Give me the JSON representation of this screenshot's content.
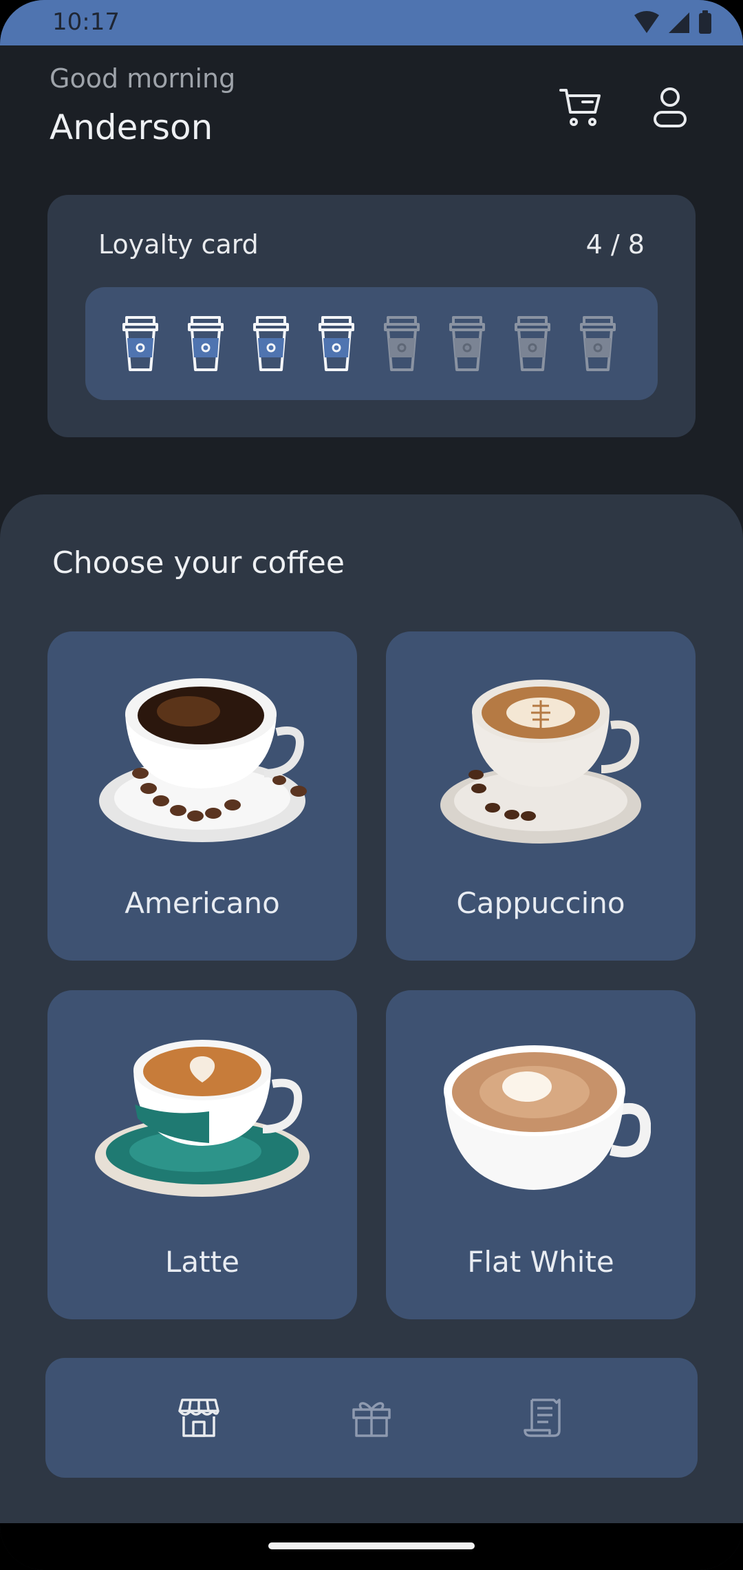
{
  "status": {
    "time": "10:17"
  },
  "header": {
    "greeting": "Good morning",
    "name": "Anderson"
  },
  "loyalty": {
    "title": "Loyalty card",
    "count_text": "4 / 8",
    "stamps_earned": 4,
    "stamps_total": 8
  },
  "section": {
    "title": "Choose your coffee"
  },
  "coffees": [
    {
      "label": "Americano",
      "image": "americano-cup-image"
    },
    {
      "label": "Cappuccino",
      "image": "cappuccino-cup-image"
    },
    {
      "label": "Latte",
      "image": "latte-cup-image"
    },
    {
      "label": "Flat White",
      "image": "flat-white-cup-image"
    }
  ],
  "nav": {
    "items": [
      "store-icon",
      "gift-icon",
      "receipt-icon"
    ],
    "active_index": 0
  },
  "colors": {
    "accent": "#4f74b0",
    "background": "#1b1f25",
    "surface": "#2f3948",
    "card": "#3e5272"
  }
}
